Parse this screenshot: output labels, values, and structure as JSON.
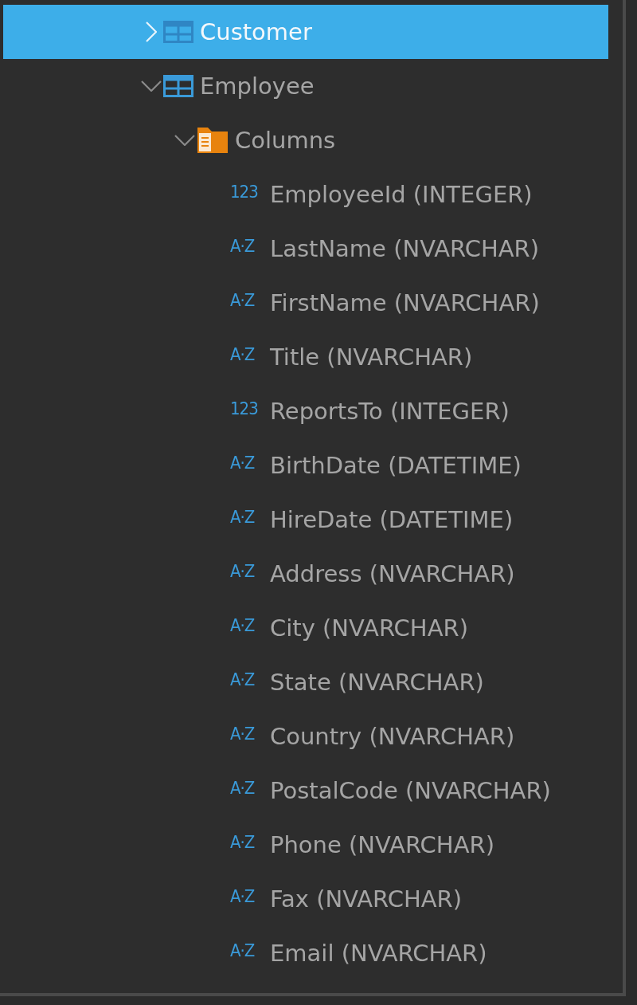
{
  "tree": [
    {
      "label": "Customer",
      "kind": "table",
      "expanded": false,
      "selected": true
    },
    {
      "label": "Employee",
      "kind": "table",
      "expanded": true,
      "selected": false,
      "children": [
        {
          "label": "Columns",
          "kind": "folder",
          "expanded": true,
          "selected": false,
          "children": [
            {
              "label": "EmployeeId (INTEGER)",
              "kind": "column",
              "type_icon": "123",
              "selected": false
            },
            {
              "label": "LastName (NVARCHAR)",
              "kind": "column",
              "type_icon": "A·Z",
              "selected": false
            },
            {
              "label": "FirstName (NVARCHAR)",
              "kind": "column",
              "type_icon": "A·Z",
              "selected": false
            },
            {
              "label": "Title (NVARCHAR)",
              "kind": "column",
              "type_icon": "A·Z",
              "selected": false
            },
            {
              "label": "ReportsTo (INTEGER)",
              "kind": "column",
              "type_icon": "123",
              "selected": false
            },
            {
              "label": "BirthDate (DATETIME)",
              "kind": "column",
              "type_icon": "A·Z",
              "selected": false
            },
            {
              "label": "HireDate (DATETIME)",
              "kind": "column",
              "type_icon": "A·Z",
              "selected": false
            },
            {
              "label": "Address (NVARCHAR)",
              "kind": "column",
              "type_icon": "A·Z",
              "selected": false
            },
            {
              "label": "City (NVARCHAR)",
              "kind": "column",
              "type_icon": "A·Z",
              "selected": false
            },
            {
              "label": "State (NVARCHAR)",
              "kind": "column",
              "type_icon": "A·Z",
              "selected": false
            },
            {
              "label": "Country (NVARCHAR)",
              "kind": "column",
              "type_icon": "A·Z",
              "selected": false
            },
            {
              "label": "PostalCode (NVARCHAR)",
              "kind": "column",
              "type_icon": "A·Z",
              "selected": false
            },
            {
              "label": "Phone (NVARCHAR)",
              "kind": "column",
              "type_icon": "A·Z",
              "selected": false
            },
            {
              "label": "Fax (NVARCHAR)",
              "kind": "column",
              "type_icon": "A·Z",
              "selected": false
            },
            {
              "label": "Email (NVARCHAR)",
              "kind": "column",
              "type_icon": "A·Z",
              "selected": false
            }
          ]
        }
      ]
    }
  ]
}
